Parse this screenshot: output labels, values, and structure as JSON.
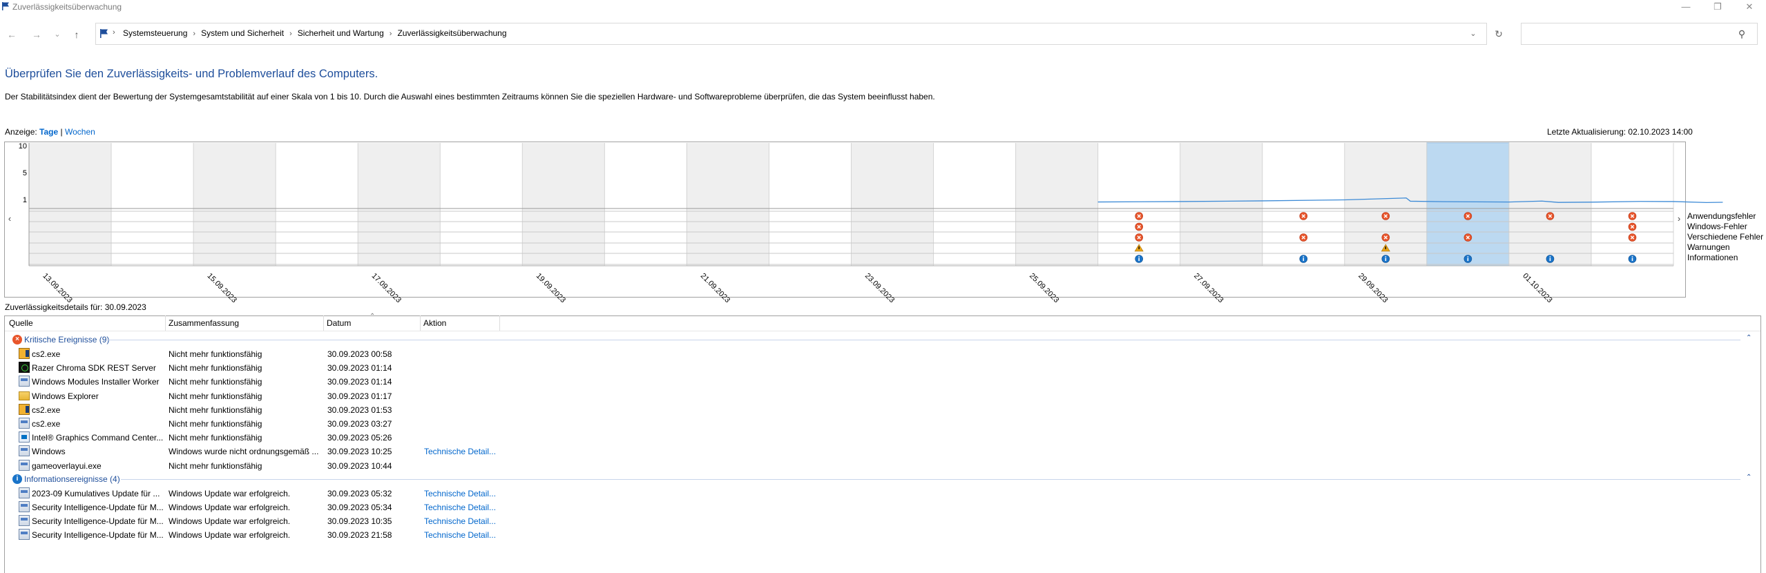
{
  "window": {
    "title": "Zuverlässigkeitsüberwachung",
    "minimize_glyph": "—",
    "maximize_glyph": "❐",
    "close_glyph": "✕"
  },
  "address_bar": {
    "back_glyph": "←",
    "forward_glyph": "→",
    "recent_glyph": "⌄",
    "up_glyph": "↑",
    "breadcrumbs": [
      "Systemsteuerung",
      "System und Sicherheit",
      "Sicherheit und Wartung",
      "Zuverlässigkeitsüberwachung"
    ],
    "separator": "›",
    "dropdown_glyph": "⌄",
    "refresh_glyph": "↻",
    "search_placeholder": "",
    "search_glyph": "⚲"
  },
  "header": {
    "headline": "Überprüfen Sie den Zuverlässigkeits- und Problemverlauf des Computers.",
    "description": "Der Stabilitätsindex dient der Bewertung der Systemgesamtstabilität auf einer Skala von 1 bis 10. Durch die Auswahl eines bestimmten Zeitraums können Sie die speziellen Hardware- und Softwareprobleme überprüfen, die das System beeinflusst haben.",
    "view_label": "Anzeige:",
    "view_days": "Tage",
    "view_separator": "|",
    "view_weeks": "Wochen",
    "last_update": "Letzte Aktualisierung: 02.10.2023 14:00"
  },
  "chart_data": {
    "type": "line",
    "y_ticks": [
      "10",
      "5",
      "1"
    ],
    "ylim": [
      1,
      10
    ],
    "columns": 20,
    "selected_column": 17,
    "date_labels": [
      "13.09.2023",
      "15.09.2023",
      "17.09.2023",
      "19.09.2023",
      "21.09.2023",
      "23.09.2023",
      "25.09.2023",
      "27.09.2023",
      "29.09.2023",
      "01.10.2023"
    ],
    "stability_index": [
      {
        "x": 13.0,
        "y": 1.05
      },
      {
        "x": 14.0,
        "y": 1.12
      },
      {
        "x": 15.0,
        "y": 1.24
      },
      {
        "x": 16.0,
        "y": 1.4
      },
      {
        "x": 16.75,
        "y": 1.72
      },
      {
        "x": 16.8,
        "y": 1.18
      },
      {
        "x": 17.2,
        "y": 1.1
      },
      {
        "x": 18.0,
        "y": 1.04
      },
      {
        "x": 18.4,
        "y": 1.2
      },
      {
        "x": 18.6,
        "y": 0.98
      },
      {
        "x": 19.0,
        "y": 1.02
      },
      {
        "x": 19.6,
        "y": 1.14
      },
      {
        "x": 20.0,
        "y": 1.12
      },
      {
        "x": 20.4,
        "y": 0.96
      },
      {
        "x": 20.6,
        "y": 1.0
      }
    ],
    "event_rows": [
      "Anwendungsfehler",
      "Windows-Fehler",
      "Verschiedene Fehler",
      "Warnungen",
      "Informationen"
    ],
    "events": [
      {
        "column": 13,
        "row": 0,
        "kind": "error"
      },
      {
        "column": 13,
        "row": 1,
        "kind": "error"
      },
      {
        "column": 13,
        "row": 2,
        "kind": "error"
      },
      {
        "column": 13,
        "row": 3,
        "kind": "warning"
      },
      {
        "column": 13,
        "row": 4,
        "kind": "info"
      },
      {
        "column": 15,
        "row": 0,
        "kind": "error"
      },
      {
        "column": 15,
        "row": 2,
        "kind": "error"
      },
      {
        "column": 15,
        "row": 4,
        "kind": "info"
      },
      {
        "column": 16,
        "row": 0,
        "kind": "error"
      },
      {
        "column": 16,
        "row": 2,
        "kind": "error"
      },
      {
        "column": 16,
        "row": 3,
        "kind": "warning"
      },
      {
        "column": 16,
        "row": 4,
        "kind": "info"
      },
      {
        "column": 17,
        "row": 0,
        "kind": "error"
      },
      {
        "column": 17,
        "row": 2,
        "kind": "error"
      },
      {
        "column": 17,
        "row": 4,
        "kind": "info"
      },
      {
        "column": 18,
        "row": 0,
        "kind": "error"
      },
      {
        "column": 18,
        "row": 4,
        "kind": "info"
      },
      {
        "column": 19,
        "row": 0,
        "kind": "error"
      },
      {
        "column": 19,
        "row": 1,
        "kind": "error"
      },
      {
        "column": 19,
        "row": 2,
        "kind": "error"
      },
      {
        "column": 19,
        "row": 4,
        "kind": "info"
      }
    ],
    "scroll_left_glyph": "‹",
    "scroll_right_glyph": "›",
    "colors": {
      "line": "#3c8ad6",
      "shaded": "#efefef",
      "selected": "#bcd9f1",
      "error": "#e8552b",
      "warning": "#e8a317",
      "info": "#1a74c9"
    }
  },
  "details": {
    "title": "Zuverlässigkeitsdetails für: 30.09.2023",
    "columns": [
      "Quelle",
      "Zusammenfassung",
      "Datum",
      "Aktion"
    ],
    "sort_glyph": "⌃",
    "collapse_glyph": "⌃",
    "groups": [
      {
        "label": "Kritische Ereignisse (9)",
        "icon": "error-icon",
        "rows": [
          {
            "icon": "cs2",
            "source": "cs2.exe",
            "summary": "Nicht mehr funktionsfähig",
            "date": "30.09.2023 00:58",
            "action": ""
          },
          {
            "icon": "razer",
            "source": "Razer Chroma SDK REST Server",
            "summary": "Nicht mehr funktionsfähig",
            "date": "30.09.2023 01:14",
            "action": ""
          },
          {
            "icon": "generic",
            "source": "Windows Modules Installer Worker",
            "summary": "Nicht mehr funktionsfähig",
            "date": "30.09.2023 01:14",
            "action": ""
          },
          {
            "icon": "folder",
            "source": "Windows Explorer",
            "summary": "Nicht mehr funktionsfähig",
            "date": "30.09.2023 01:17",
            "action": ""
          },
          {
            "icon": "cs2",
            "source": "cs2.exe",
            "summary": "Nicht mehr funktionsfähig",
            "date": "30.09.2023 01:53",
            "action": ""
          },
          {
            "icon": "generic",
            "source": "cs2.exe",
            "summary": "Nicht mehr funktionsfähig",
            "date": "30.09.2023 03:27",
            "action": ""
          },
          {
            "icon": "intel",
            "source": "Intel® Graphics Command Center...",
            "summary": "Nicht mehr funktionsfähig",
            "date": "30.09.2023 05:26",
            "action": ""
          },
          {
            "icon": "generic",
            "source": "Windows",
            "summary": "Windows wurde nicht ordnungsgemäß ...",
            "date": "30.09.2023 10:25",
            "action": "Technische Detail..."
          },
          {
            "icon": "generic",
            "source": "gameoverlayui.exe",
            "summary": "Nicht mehr funktionsfähig",
            "date": "30.09.2023 10:44",
            "action": ""
          }
        ]
      },
      {
        "label": "Informationsereignisse (4)",
        "icon": "info-icon",
        "rows": [
          {
            "icon": "generic",
            "source": "2023-09 Kumulatives Update für ...",
            "summary": "Windows Update war erfolgreich.",
            "date": "30.09.2023 05:32",
            "action": "Technische Detail..."
          },
          {
            "icon": "generic",
            "source": "Security Intelligence-Update für M...",
            "summary": "Windows Update war erfolgreich.",
            "date": "30.09.2023 05:34",
            "action": "Technische Detail..."
          },
          {
            "icon": "generic",
            "source": "Security Intelligence-Update für M...",
            "summary": "Windows Update war erfolgreich.",
            "date": "30.09.2023 10:35",
            "action": "Technische Detail..."
          },
          {
            "icon": "generic",
            "source": "Security Intelligence-Update für M...",
            "summary": "Windows Update war erfolgreich.",
            "date": "30.09.2023 21:58",
            "action": "Technische Detail..."
          }
        ]
      }
    ]
  }
}
